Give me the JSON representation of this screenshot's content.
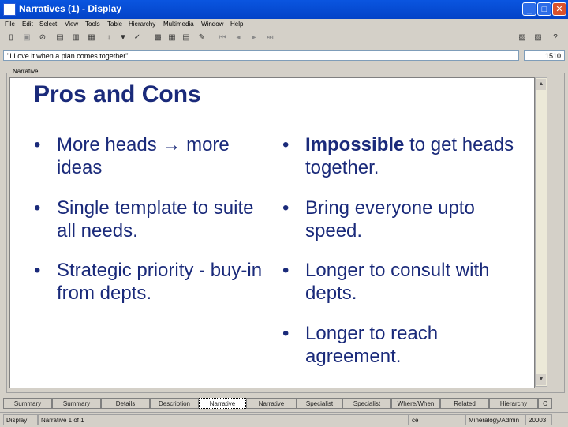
{
  "window": {
    "title": "Narratives (1) - Display"
  },
  "menu": [
    "File",
    "Edit",
    "Select",
    "View",
    "Tools",
    "Table",
    "Hierarchy",
    "Multimedia",
    "Window",
    "Help"
  ],
  "address": {
    "value": "\"I Love it when a plan comes together\"",
    "number": "1510"
  },
  "group_label": "Narrative",
  "slide": {
    "title": "Pros and Cons",
    "bullet_char": "•",
    "pros": [
      {
        "line1": "More heads → more",
        "line2": "ideas"
      },
      {
        "line1": "Single template to suite",
        "line2": "all needs."
      },
      {
        "line1": "Strategic priority - buy-in",
        "line2": "from depts."
      }
    ],
    "cons": [
      {
        "bold": "Impossible",
        "rest": " to get heads",
        "line2": "together."
      },
      {
        "line1": "Bring everyone upto",
        "line2": "speed."
      },
      {
        "line1": "Longer to consult with",
        "line2": "depts."
      },
      {
        "line1": "Longer to reach",
        "line2": "agreement."
      }
    ]
  },
  "tabs": [
    "Summary",
    "Summary",
    "Details",
    "Description",
    "Narrative",
    "Narrative",
    "Specialist",
    "Specialist",
    "Where/When",
    "Related",
    "Hierarchy",
    "C"
  ],
  "active_tab": 4,
  "status": {
    "mode": "Display",
    "record": "Narrative 1 of 1",
    "flag": "ce",
    "user": "Mineralogy/Admin",
    "code": "20003"
  }
}
